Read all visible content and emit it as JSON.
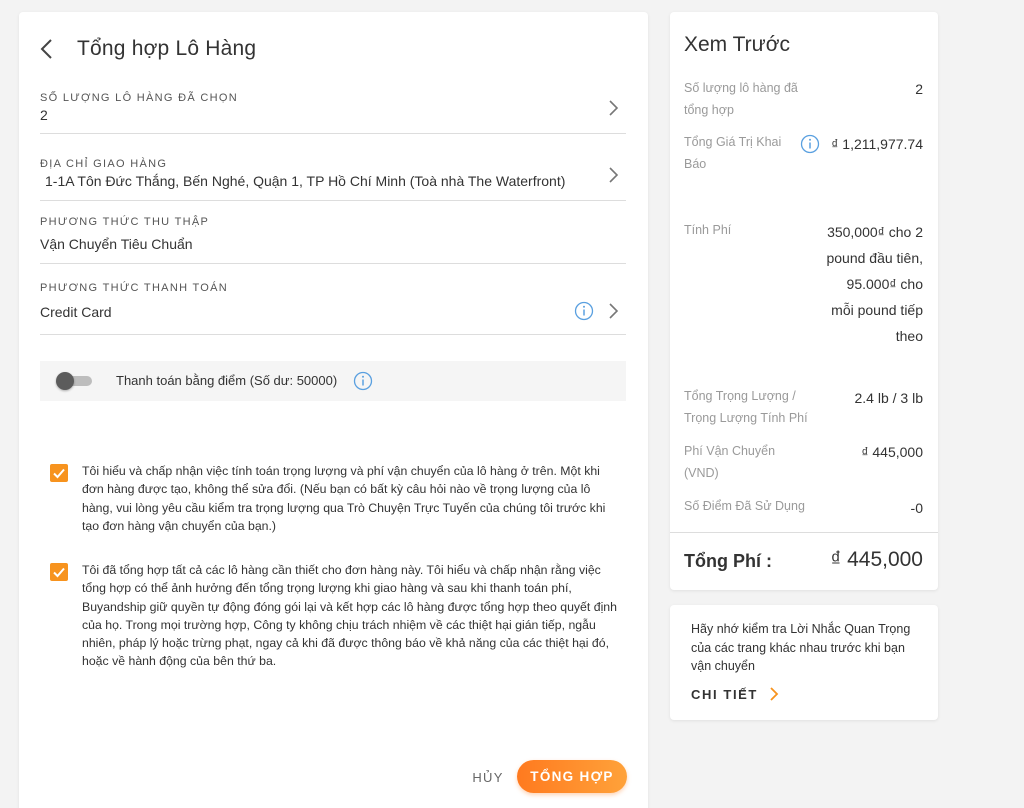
{
  "header": {
    "title": "Tổng hợp Lô Hàng"
  },
  "fields": {
    "quantity": {
      "label": "SỐ LƯỢNG LÔ HÀNG ĐÃ CHỌN",
      "value": "2"
    },
    "address": {
      "label": "ĐỊA CHỈ GIAO HÀNG",
      "value": "1-1A Tôn Đức Thắng, Bến Nghé, Quận 1, TP Hồ Chí Minh (Toà nhà The Waterfront)"
    },
    "collection": {
      "label": "PHƯƠNG THỨC THU THẬP",
      "value": "Vận Chuyển Tiêu Chuẩn"
    },
    "payment": {
      "label": "PHƯƠNG THỨC THANH TOÁN",
      "value": "Credit Card"
    }
  },
  "points": {
    "label": "Thanh toán bằng điểm (Số dư: 50000)",
    "enabled": false
  },
  "agreements": [
    {
      "checked": true,
      "text": "Tôi hiểu và chấp nhận việc tính toán trọng lượng và phí vận chuyển của lô hàng ở trên. Một khi đơn hàng được tạo, không thể sửa đổi. (Nếu bạn có bất kỳ câu hỏi nào về trọng lượng của lô hàng, vui lòng yêu cầu kiểm tra trọng lượng qua Trò Chuyện Trực Tuyến của chúng tôi trước khi tạo đơn hàng vận chuyển của bạn.)"
    },
    {
      "checked": true,
      "text": "Tôi đã tổng hợp tất cả các lô hàng cần thiết cho đơn hàng này. Tôi hiểu và chấp nhận rằng việc tổng hợp có thể ảnh hưởng đến tổng trọng lượng khi giao hàng và sau khi thanh toán phí, Buyandship giữ quyền tự động đóng gói lại và kết hợp các lô hàng được tổng hợp theo quyết định của họ. Trong mọi trường hợp, Công ty không chịu trách nhiệm về các thiệt hại gián tiếp, ngẫu nhiên, pháp lý hoặc trừng phạt, ngay cả khi đã được thông báo về khả năng của các thiệt hại đó, hoặc về hành động của bên thứ ba."
    }
  ],
  "actions": {
    "cancel_label": "HỦY",
    "submit_label": "TỔNG HỢP"
  },
  "preview": {
    "title": "Xem Trước",
    "rows": [
      {
        "label": "Số lượng lô hàng đã tổng hợp",
        "value": "2"
      },
      {
        "label": "Tổng Giá Trị Khai Báo",
        "value": "₫ 1,211,977.74"
      },
      {
        "label": "Tính Phí",
        "value": "350,000₫ cho 2 pound đầu tiên, 95.000₫ cho mỗi pound tiếp theo"
      },
      {
        "label": "Tổng Trọng Lượng / Trọng Lượng Tính Phí",
        "value": "2.4 lb / 3 lb"
      },
      {
        "label": "Phí Vận Chuyển (VND)",
        "value": "₫ 445,000"
      },
      {
        "label": "Số Điểm Đã Sử Dụng",
        "value": "-0"
      }
    ],
    "total_label": "Tổng Phí :",
    "total_value": "₫ 445,000"
  },
  "notice": {
    "text": "Hãy nhớ kiểm tra Lời Nhắc Quan Trọng của các trang khác nhau trước khi bạn vận chuyển",
    "link_label": "CHI TIẾT"
  },
  "colors": {
    "accent": "#f7931e",
    "info": "#5aa0e0"
  },
  "icons": [
    "back-arrow-icon",
    "chevron-right-icon",
    "info-icon",
    "check-icon"
  ]
}
